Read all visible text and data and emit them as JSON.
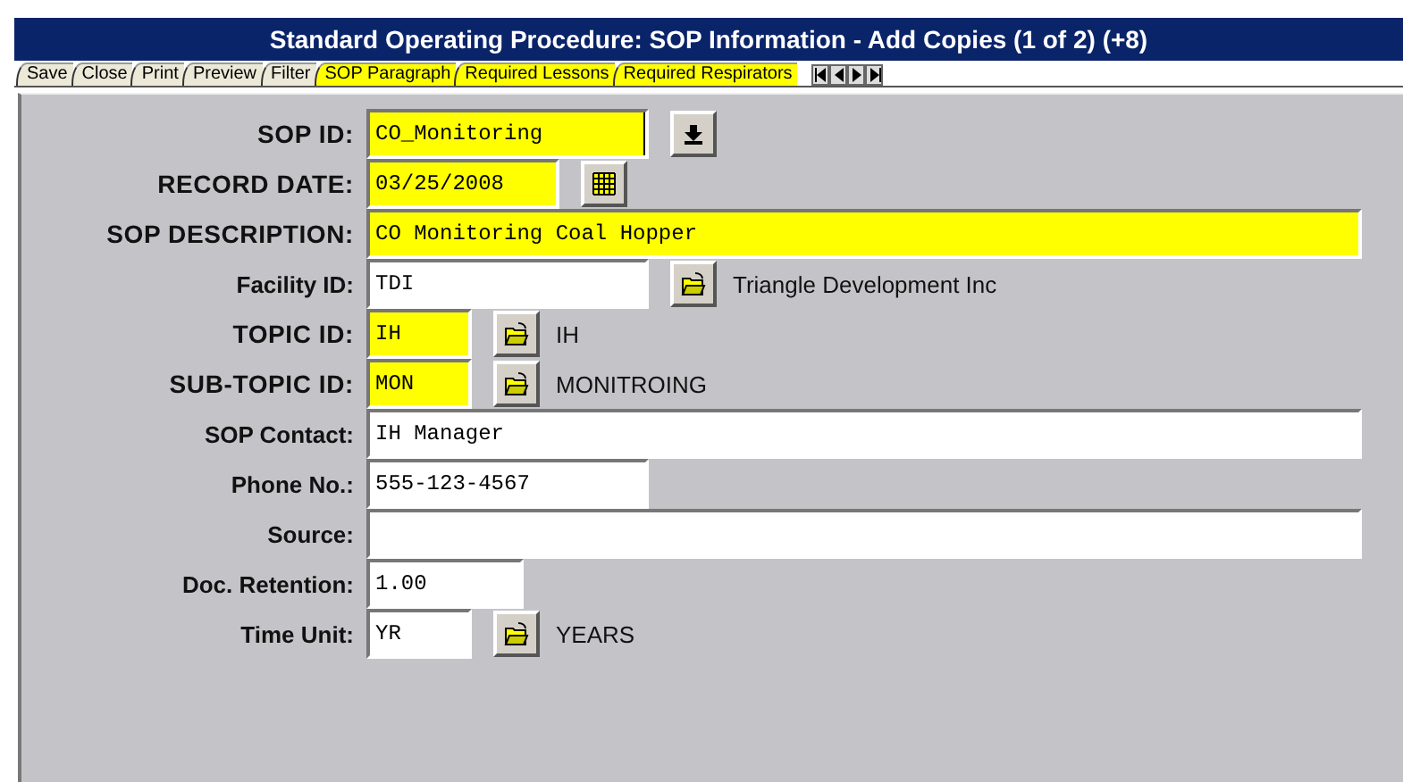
{
  "window": {
    "title": "Standard Operating Procedure: SOP Information - Add Copies (1 of 2) (+8)"
  },
  "tabs": [
    {
      "label": "Save",
      "highlighted": false
    },
    {
      "label": "Close",
      "highlighted": false
    },
    {
      "label": "Print",
      "highlighted": false
    },
    {
      "label": "Preview",
      "highlighted": false
    },
    {
      "label": "Filter",
      "highlighted": false
    },
    {
      "label": "SOP Paragraph",
      "highlighted": true
    },
    {
      "label": "Required Lessons",
      "highlighted": true
    },
    {
      "label": "Required Respirators",
      "highlighted": true
    }
  ],
  "fields": [
    {
      "kind": "key",
      "label": "SOP ID:",
      "value": "CO_Monitoring",
      "required": true,
      "focused": true
    },
    {
      "kind": "date",
      "label": "RECORD DATE:",
      "value": "03/25/2008",
      "required": true
    },
    {
      "kind": "text",
      "label": "SOP DESCRIPTION:",
      "value": "CO Monitoring Coal Hopper",
      "required": true
    },
    {
      "kind": "id",
      "label": "Facility ID:",
      "value": "TDI",
      "required": false,
      "description": "Triangle Development Inc"
    },
    {
      "kind": "code",
      "label": "TOPIC ID:",
      "value": "IH",
      "required": true,
      "description": "IH"
    },
    {
      "kind": "code",
      "label": "SUB-TOPIC ID:",
      "value": "MON",
      "required": true,
      "description": "MONITROING"
    },
    {
      "kind": "text",
      "label": "SOP Contact:",
      "value": "IH Manager",
      "required": false
    },
    {
      "kind": "phone",
      "label": "Phone No.:",
      "value": "555-123-4567",
      "required": false
    },
    {
      "kind": "text",
      "label": "Source:",
      "required": false
    },
    {
      "kind": "number",
      "label": "Doc. Retention:",
      "value": "1.00",
      "required": false
    },
    {
      "kind": "code",
      "label": "Time Unit:",
      "value": "YR",
      "required": false,
      "description": "YEARS"
    }
  ]
}
